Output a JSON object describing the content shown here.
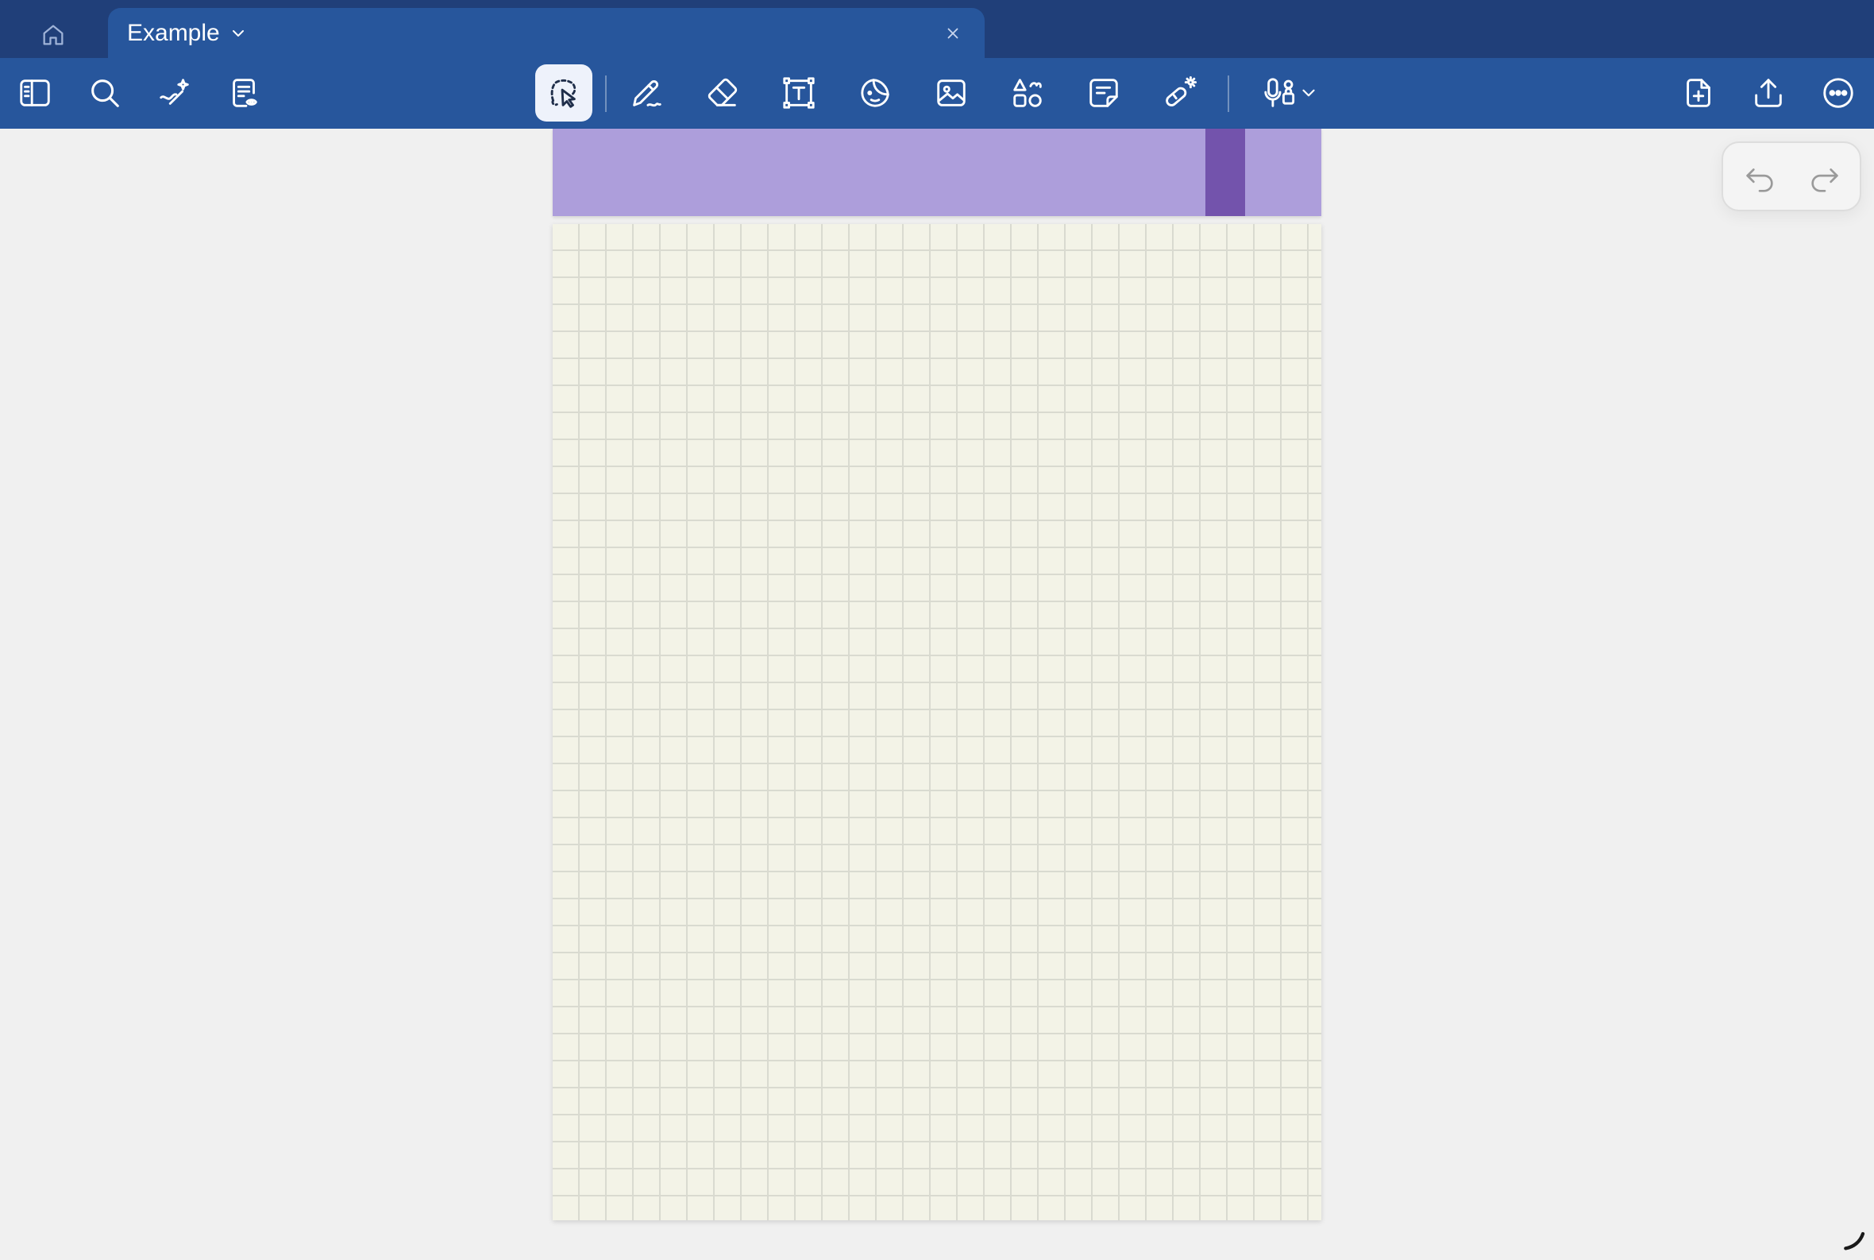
{
  "tab": {
    "title": "Example"
  },
  "icons": {
    "home": "home-icon",
    "tab_dropdown": "chevron-down-icon",
    "tab_close": "close-icon",
    "sidebar": "sidebar-toggle-icon",
    "search": "search-icon",
    "ai_assist": "sparkle-pen-icon",
    "document_view": "document-eye-icon",
    "lasso": "lasso-select-icon",
    "pen": "pen-icon",
    "eraser": "eraser-icon",
    "text": "text-box-icon",
    "sticker": "sticker-icon",
    "image": "image-icon",
    "shapes": "shapes-icon",
    "sticky_note": "sticky-note-icon",
    "laser": "laser-pointer-icon",
    "record": "microphone-lock-icon",
    "add_page": "add-page-icon",
    "share": "share-icon",
    "more": "more-options-icon",
    "undo": "undo-icon",
    "redo": "redo-icon"
  },
  "colors": {
    "tab_strip": "#203f79",
    "toolbar": "#27569c",
    "header_strip": "#ad9edb",
    "header_accent": "#7353ac",
    "paper": "#f3f3e7",
    "grid_line": "#d9dad0"
  },
  "toolbar": {
    "active_tool": "lasso"
  }
}
